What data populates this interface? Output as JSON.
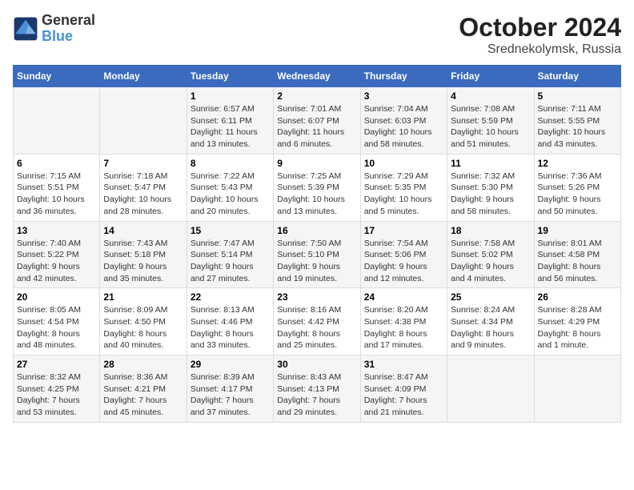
{
  "logo": {
    "line1": "General",
    "line2": "Blue"
  },
  "title": "October 2024",
  "subtitle": "Srednekolymsk, Russia",
  "weekdays": [
    "Sunday",
    "Monday",
    "Tuesday",
    "Wednesday",
    "Thursday",
    "Friday",
    "Saturday"
  ],
  "weeks": [
    [
      {
        "day": "",
        "info": ""
      },
      {
        "day": "",
        "info": ""
      },
      {
        "day": "1",
        "info": "Sunrise: 6:57 AM\nSunset: 6:11 PM\nDaylight: 11 hours\nand 13 minutes."
      },
      {
        "day": "2",
        "info": "Sunrise: 7:01 AM\nSunset: 6:07 PM\nDaylight: 11 hours\nand 6 minutes."
      },
      {
        "day": "3",
        "info": "Sunrise: 7:04 AM\nSunset: 6:03 PM\nDaylight: 10 hours\nand 58 minutes."
      },
      {
        "day": "4",
        "info": "Sunrise: 7:08 AM\nSunset: 5:59 PM\nDaylight: 10 hours\nand 51 minutes."
      },
      {
        "day": "5",
        "info": "Sunrise: 7:11 AM\nSunset: 5:55 PM\nDaylight: 10 hours\nand 43 minutes."
      }
    ],
    [
      {
        "day": "6",
        "info": "Sunrise: 7:15 AM\nSunset: 5:51 PM\nDaylight: 10 hours\nand 36 minutes."
      },
      {
        "day": "7",
        "info": "Sunrise: 7:18 AM\nSunset: 5:47 PM\nDaylight: 10 hours\nand 28 minutes."
      },
      {
        "day": "8",
        "info": "Sunrise: 7:22 AM\nSunset: 5:43 PM\nDaylight: 10 hours\nand 20 minutes."
      },
      {
        "day": "9",
        "info": "Sunrise: 7:25 AM\nSunset: 5:39 PM\nDaylight: 10 hours\nand 13 minutes."
      },
      {
        "day": "10",
        "info": "Sunrise: 7:29 AM\nSunset: 5:35 PM\nDaylight: 10 hours\nand 5 minutes."
      },
      {
        "day": "11",
        "info": "Sunrise: 7:32 AM\nSunset: 5:30 PM\nDaylight: 9 hours\nand 58 minutes."
      },
      {
        "day": "12",
        "info": "Sunrise: 7:36 AM\nSunset: 5:26 PM\nDaylight: 9 hours\nand 50 minutes."
      }
    ],
    [
      {
        "day": "13",
        "info": "Sunrise: 7:40 AM\nSunset: 5:22 PM\nDaylight: 9 hours\nand 42 minutes."
      },
      {
        "day": "14",
        "info": "Sunrise: 7:43 AM\nSunset: 5:18 PM\nDaylight: 9 hours\nand 35 minutes."
      },
      {
        "day": "15",
        "info": "Sunrise: 7:47 AM\nSunset: 5:14 PM\nDaylight: 9 hours\nand 27 minutes."
      },
      {
        "day": "16",
        "info": "Sunrise: 7:50 AM\nSunset: 5:10 PM\nDaylight: 9 hours\nand 19 minutes."
      },
      {
        "day": "17",
        "info": "Sunrise: 7:54 AM\nSunset: 5:06 PM\nDaylight: 9 hours\nand 12 minutes."
      },
      {
        "day": "18",
        "info": "Sunrise: 7:58 AM\nSunset: 5:02 PM\nDaylight: 9 hours\nand 4 minutes."
      },
      {
        "day": "19",
        "info": "Sunrise: 8:01 AM\nSunset: 4:58 PM\nDaylight: 8 hours\nand 56 minutes."
      }
    ],
    [
      {
        "day": "20",
        "info": "Sunrise: 8:05 AM\nSunset: 4:54 PM\nDaylight: 8 hours\nand 48 minutes."
      },
      {
        "day": "21",
        "info": "Sunrise: 8:09 AM\nSunset: 4:50 PM\nDaylight: 8 hours\nand 40 minutes."
      },
      {
        "day": "22",
        "info": "Sunrise: 8:13 AM\nSunset: 4:46 PM\nDaylight: 8 hours\nand 33 minutes."
      },
      {
        "day": "23",
        "info": "Sunrise: 8:16 AM\nSunset: 4:42 PM\nDaylight: 8 hours\nand 25 minutes."
      },
      {
        "day": "24",
        "info": "Sunrise: 8:20 AM\nSunset: 4:38 PM\nDaylight: 8 hours\nand 17 minutes."
      },
      {
        "day": "25",
        "info": "Sunrise: 8:24 AM\nSunset: 4:34 PM\nDaylight: 8 hours\nand 9 minutes."
      },
      {
        "day": "26",
        "info": "Sunrise: 8:28 AM\nSunset: 4:29 PM\nDaylight: 8 hours\nand 1 minute."
      }
    ],
    [
      {
        "day": "27",
        "info": "Sunrise: 8:32 AM\nSunset: 4:25 PM\nDaylight: 7 hours\nand 53 minutes."
      },
      {
        "day": "28",
        "info": "Sunrise: 8:36 AM\nSunset: 4:21 PM\nDaylight: 7 hours\nand 45 minutes."
      },
      {
        "day": "29",
        "info": "Sunrise: 8:39 AM\nSunset: 4:17 PM\nDaylight: 7 hours\nand 37 minutes."
      },
      {
        "day": "30",
        "info": "Sunrise: 8:43 AM\nSunset: 4:13 PM\nDaylight: 7 hours\nand 29 minutes."
      },
      {
        "day": "31",
        "info": "Sunrise: 8:47 AM\nSunset: 4:09 PM\nDaylight: 7 hours\nand 21 minutes."
      },
      {
        "day": "",
        "info": ""
      },
      {
        "day": "",
        "info": ""
      }
    ]
  ]
}
